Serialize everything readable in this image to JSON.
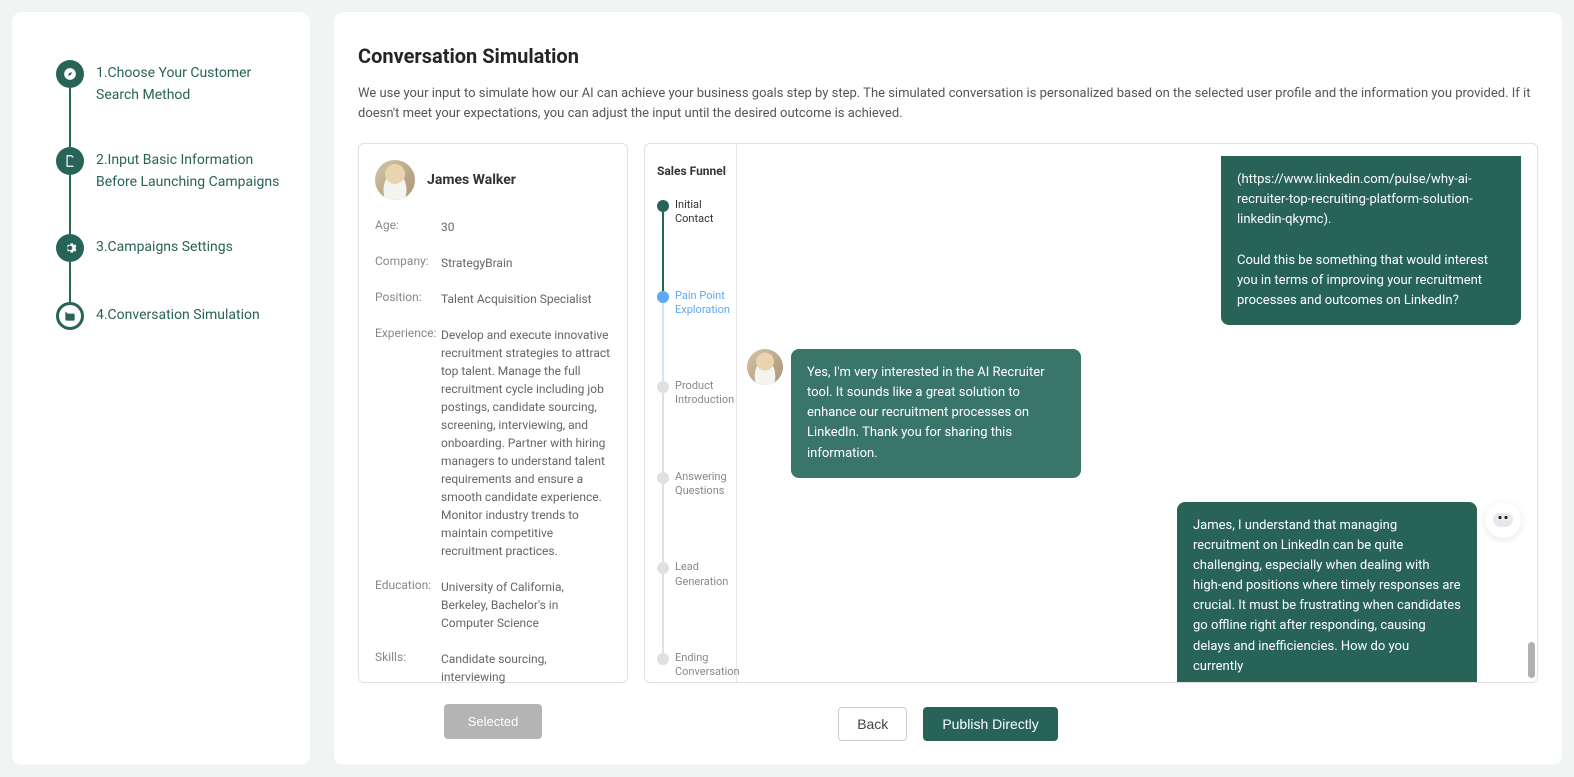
{
  "sidebar": {
    "steps": [
      {
        "label": "1.Choose Your Customer Search Method"
      },
      {
        "label": "2.Input Basic Information Before Launching Campaigns"
      },
      {
        "label": "3.Campaigns Settings"
      },
      {
        "label": "4.Conversation Simulation"
      }
    ]
  },
  "header": {
    "title": "Conversation Simulation",
    "description": "We use your input to simulate how our AI can achieve your business goals step by step. The simulated conversation is personalized based on the selected user profile and the information you provided. If it doesn't meet your expectations, you can adjust the input until the desired outcome is achieved."
  },
  "profile": {
    "name": "James Walker",
    "fields": {
      "age_label": "Age:",
      "age_value": "30",
      "company_label": "Company:",
      "company_value": "StrategyBrain",
      "position_label": "Position:",
      "position_value": "Talent Acquisition Specialist",
      "experience_label": "Experience:",
      "experience_value": "Develop and execute innovative recruitment strategies to attract top talent. Manage the full recruitment cycle including job postings, candidate sourcing, screening, interviewing, and onboarding. Partner with hiring managers to understand talent requirements and ensure a smooth candidate experience. Monitor industry trends to maintain competitive recruitment practices.",
      "education_label": "Education:",
      "education_value": "University of California, Berkeley, Bachelor's in Computer Science",
      "skills_label": "Skills:",
      "skills_value": "Candidate sourcing, interviewing"
    },
    "selected_button": "Selected"
  },
  "funnel": {
    "title": "Sales Funnel",
    "steps": [
      {
        "label": "Initial Contact",
        "state": "done"
      },
      {
        "label": "Pain Point Exploration",
        "state": "current"
      },
      {
        "label": "Product Introduction",
        "state": "pending"
      },
      {
        "label": "Answering Questions",
        "state": "pending"
      },
      {
        "label": "Lead Generation",
        "state": "pending"
      },
      {
        "label": "Ending Conversation",
        "state": "pending"
      }
    ]
  },
  "chat": {
    "messages": [
      {
        "side": "right",
        "sender": "bot",
        "cut": true,
        "text": "(https://www.linkedin.com/pulse/why-ai-recruiter-top-recruiting-platform-solution-linkedin-qkymc).\n\nCould this be something that would interest you in terms of improving your recruitment processes and outcomes on LinkedIn?"
      },
      {
        "side": "left",
        "sender": "user",
        "text": "Yes, I'm very interested in the AI Recruiter tool. It sounds like a great solution to enhance our recruitment processes on LinkedIn. Thank you for sharing this information."
      },
      {
        "side": "right",
        "sender": "bot",
        "text": "James, I understand that managing recruitment on LinkedIn can be quite challenging, especially when dealing with high-end positions where timely responses are crucial. It must be frustrating when candidates go offline right after responding, causing delays and inefficiencies. How do you currently"
      }
    ]
  },
  "footer": {
    "back": "Back",
    "publish": "Publish Directly"
  }
}
